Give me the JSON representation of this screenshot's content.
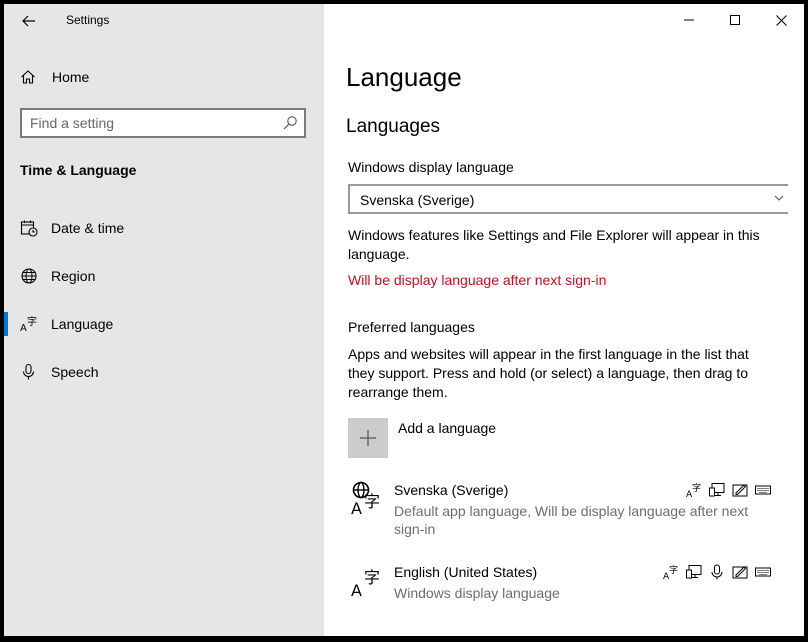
{
  "window": {
    "title": "Settings"
  },
  "sidebar": {
    "home_label": "Home",
    "search_placeholder": "Find a setting",
    "section_title": "Time & Language",
    "items": [
      {
        "label": "Date & time",
        "icon": "calendar-clock-icon",
        "selected": false
      },
      {
        "label": "Region",
        "icon": "globe-icon",
        "selected": false
      },
      {
        "label": "Language",
        "icon": "language-icon",
        "selected": true
      },
      {
        "label": "Speech",
        "icon": "microphone-icon",
        "selected": false
      }
    ]
  },
  "main": {
    "page_title": "Language",
    "section_title": "Languages",
    "display_language_label": "Windows display language",
    "display_language_value": "Svenska (Sverige)",
    "display_language_desc": "Windows features like Settings and File Explorer will appear in this language.",
    "display_language_warning": "Will be display language after next sign-in",
    "preferred_label": "Preferred languages",
    "preferred_desc": "Apps and websites will appear in the first language in the list that they support. Press and hold (or select) a language, then drag to rearrange them.",
    "add_language_label": "Add a language",
    "languages": [
      {
        "name": "Svenska (Sverige)",
        "desc": "Default app language, Will be display language after next sign-in",
        "features": [
          "language-pack-icon",
          "display-icon",
          "handwriting-icon",
          "keyboard-icon"
        ]
      },
      {
        "name": "English (United States)",
        "desc": "Windows display language",
        "features": [
          "language-pack-icon",
          "display-icon",
          "speech-icon",
          "handwriting-icon",
          "keyboard-icon"
        ]
      }
    ]
  },
  "colors": {
    "sidebar_bg": "#e6e6e6",
    "accent": "#0078d7",
    "warning": "#c50f1f",
    "add_button_bg": "#cccccc",
    "secondary_text": "#6d6d6d"
  }
}
